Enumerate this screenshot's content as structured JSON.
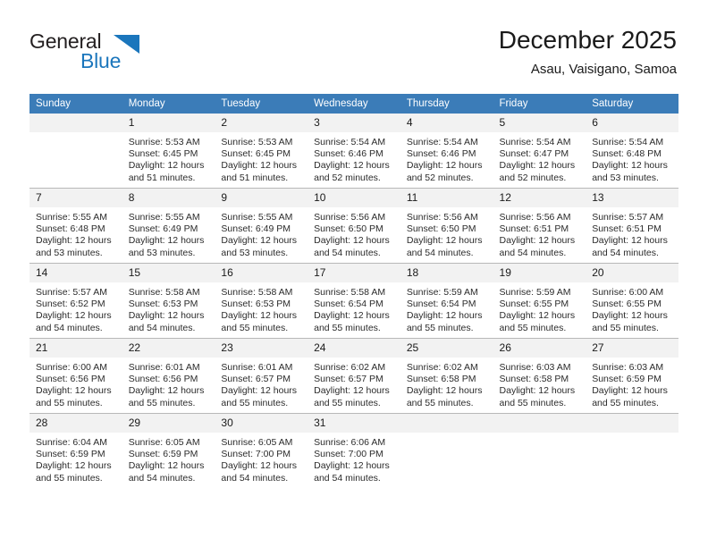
{
  "brand": {
    "name_part1": "General",
    "name_part2": "Blue",
    "logo_icon": "triangle-logo-icon",
    "accent_color": "#1b76bc"
  },
  "header": {
    "title": "December 2025",
    "subtitle": "Asau, Vaisigano, Samoa"
  },
  "calendar": {
    "header_bg": "#3b7cb8",
    "daynum_bg": "#f2f2f2",
    "weekday_headers": [
      "Sunday",
      "Monday",
      "Tuesday",
      "Wednesday",
      "Thursday",
      "Friday",
      "Saturday"
    ],
    "weeks": [
      [
        {
          "day": "",
          "sunrise": "",
          "sunset": "",
          "daylight1": "",
          "daylight2": ""
        },
        {
          "day": "1",
          "sunrise": "Sunrise: 5:53 AM",
          "sunset": "Sunset: 6:45 PM",
          "daylight1": "Daylight: 12 hours",
          "daylight2": "and 51 minutes."
        },
        {
          "day": "2",
          "sunrise": "Sunrise: 5:53 AM",
          "sunset": "Sunset: 6:45 PM",
          "daylight1": "Daylight: 12 hours",
          "daylight2": "and 51 minutes."
        },
        {
          "day": "3",
          "sunrise": "Sunrise: 5:54 AM",
          "sunset": "Sunset: 6:46 PM",
          "daylight1": "Daylight: 12 hours",
          "daylight2": "and 52 minutes."
        },
        {
          "day": "4",
          "sunrise": "Sunrise: 5:54 AM",
          "sunset": "Sunset: 6:46 PM",
          "daylight1": "Daylight: 12 hours",
          "daylight2": "and 52 minutes."
        },
        {
          "day": "5",
          "sunrise": "Sunrise: 5:54 AM",
          "sunset": "Sunset: 6:47 PM",
          "daylight1": "Daylight: 12 hours",
          "daylight2": "and 52 minutes."
        },
        {
          "day": "6",
          "sunrise": "Sunrise: 5:54 AM",
          "sunset": "Sunset: 6:48 PM",
          "daylight1": "Daylight: 12 hours",
          "daylight2": "and 53 minutes."
        }
      ],
      [
        {
          "day": "7",
          "sunrise": "Sunrise: 5:55 AM",
          "sunset": "Sunset: 6:48 PM",
          "daylight1": "Daylight: 12 hours",
          "daylight2": "and 53 minutes."
        },
        {
          "day": "8",
          "sunrise": "Sunrise: 5:55 AM",
          "sunset": "Sunset: 6:49 PM",
          "daylight1": "Daylight: 12 hours",
          "daylight2": "and 53 minutes."
        },
        {
          "day": "9",
          "sunrise": "Sunrise: 5:55 AM",
          "sunset": "Sunset: 6:49 PM",
          "daylight1": "Daylight: 12 hours",
          "daylight2": "and 53 minutes."
        },
        {
          "day": "10",
          "sunrise": "Sunrise: 5:56 AM",
          "sunset": "Sunset: 6:50 PM",
          "daylight1": "Daylight: 12 hours",
          "daylight2": "and 54 minutes."
        },
        {
          "day": "11",
          "sunrise": "Sunrise: 5:56 AM",
          "sunset": "Sunset: 6:50 PM",
          "daylight1": "Daylight: 12 hours",
          "daylight2": "and 54 minutes."
        },
        {
          "day": "12",
          "sunrise": "Sunrise: 5:56 AM",
          "sunset": "Sunset: 6:51 PM",
          "daylight1": "Daylight: 12 hours",
          "daylight2": "and 54 minutes."
        },
        {
          "day": "13",
          "sunrise": "Sunrise: 5:57 AM",
          "sunset": "Sunset: 6:51 PM",
          "daylight1": "Daylight: 12 hours",
          "daylight2": "and 54 minutes."
        }
      ],
      [
        {
          "day": "14",
          "sunrise": "Sunrise: 5:57 AM",
          "sunset": "Sunset: 6:52 PM",
          "daylight1": "Daylight: 12 hours",
          "daylight2": "and 54 minutes."
        },
        {
          "day": "15",
          "sunrise": "Sunrise: 5:58 AM",
          "sunset": "Sunset: 6:53 PM",
          "daylight1": "Daylight: 12 hours",
          "daylight2": "and 54 minutes."
        },
        {
          "day": "16",
          "sunrise": "Sunrise: 5:58 AM",
          "sunset": "Sunset: 6:53 PM",
          "daylight1": "Daylight: 12 hours",
          "daylight2": "and 55 minutes."
        },
        {
          "day": "17",
          "sunrise": "Sunrise: 5:58 AM",
          "sunset": "Sunset: 6:54 PM",
          "daylight1": "Daylight: 12 hours",
          "daylight2": "and 55 minutes."
        },
        {
          "day": "18",
          "sunrise": "Sunrise: 5:59 AM",
          "sunset": "Sunset: 6:54 PM",
          "daylight1": "Daylight: 12 hours",
          "daylight2": "and 55 minutes."
        },
        {
          "day": "19",
          "sunrise": "Sunrise: 5:59 AM",
          "sunset": "Sunset: 6:55 PM",
          "daylight1": "Daylight: 12 hours",
          "daylight2": "and 55 minutes."
        },
        {
          "day": "20",
          "sunrise": "Sunrise: 6:00 AM",
          "sunset": "Sunset: 6:55 PM",
          "daylight1": "Daylight: 12 hours",
          "daylight2": "and 55 minutes."
        }
      ],
      [
        {
          "day": "21",
          "sunrise": "Sunrise: 6:00 AM",
          "sunset": "Sunset: 6:56 PM",
          "daylight1": "Daylight: 12 hours",
          "daylight2": "and 55 minutes."
        },
        {
          "day": "22",
          "sunrise": "Sunrise: 6:01 AM",
          "sunset": "Sunset: 6:56 PM",
          "daylight1": "Daylight: 12 hours",
          "daylight2": "and 55 minutes."
        },
        {
          "day": "23",
          "sunrise": "Sunrise: 6:01 AM",
          "sunset": "Sunset: 6:57 PM",
          "daylight1": "Daylight: 12 hours",
          "daylight2": "and 55 minutes."
        },
        {
          "day": "24",
          "sunrise": "Sunrise: 6:02 AM",
          "sunset": "Sunset: 6:57 PM",
          "daylight1": "Daylight: 12 hours",
          "daylight2": "and 55 minutes."
        },
        {
          "day": "25",
          "sunrise": "Sunrise: 6:02 AM",
          "sunset": "Sunset: 6:58 PM",
          "daylight1": "Daylight: 12 hours",
          "daylight2": "and 55 minutes."
        },
        {
          "day": "26",
          "sunrise": "Sunrise: 6:03 AM",
          "sunset": "Sunset: 6:58 PM",
          "daylight1": "Daylight: 12 hours",
          "daylight2": "and 55 minutes."
        },
        {
          "day": "27",
          "sunrise": "Sunrise: 6:03 AM",
          "sunset": "Sunset: 6:59 PM",
          "daylight1": "Daylight: 12 hours",
          "daylight2": "and 55 minutes."
        }
      ],
      [
        {
          "day": "28",
          "sunrise": "Sunrise: 6:04 AM",
          "sunset": "Sunset: 6:59 PM",
          "daylight1": "Daylight: 12 hours",
          "daylight2": "and 55 minutes."
        },
        {
          "day": "29",
          "sunrise": "Sunrise: 6:05 AM",
          "sunset": "Sunset: 6:59 PM",
          "daylight1": "Daylight: 12 hours",
          "daylight2": "and 54 minutes."
        },
        {
          "day": "30",
          "sunrise": "Sunrise: 6:05 AM",
          "sunset": "Sunset: 7:00 PM",
          "daylight1": "Daylight: 12 hours",
          "daylight2": "and 54 minutes."
        },
        {
          "day": "31",
          "sunrise": "Sunrise: 6:06 AM",
          "sunset": "Sunset: 7:00 PM",
          "daylight1": "Daylight: 12 hours",
          "daylight2": "and 54 minutes."
        },
        {
          "day": "",
          "sunrise": "",
          "sunset": "",
          "daylight1": "",
          "daylight2": ""
        },
        {
          "day": "",
          "sunrise": "",
          "sunset": "",
          "daylight1": "",
          "daylight2": ""
        },
        {
          "day": "",
          "sunrise": "",
          "sunset": "",
          "daylight1": "",
          "daylight2": ""
        }
      ]
    ]
  }
}
